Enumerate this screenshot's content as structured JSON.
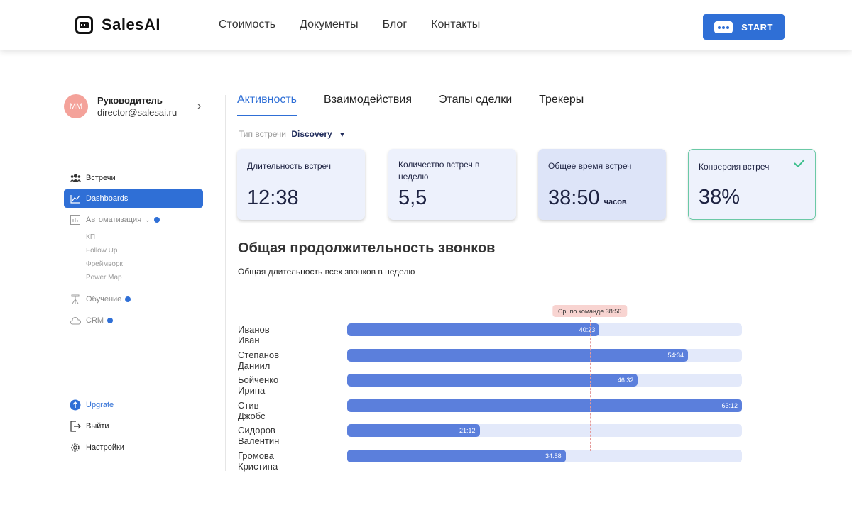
{
  "brand": {
    "name": "SalesAI"
  },
  "nav": [
    "Стоимость",
    "Документы",
    "Блог",
    "Контакты"
  ],
  "start_button": "START",
  "profile": {
    "initials": "MM",
    "role": "Руководитель",
    "email": "director@salesai.ru"
  },
  "sidebar": {
    "items": [
      {
        "label": "Встречи",
        "icon": "users-icon"
      },
      {
        "label": "Dashboards",
        "icon": "chart-line-icon",
        "active": true
      },
      {
        "label": "Автоматизация",
        "icon": "automation-icon"
      }
    ],
    "sub_items": [
      "КП",
      "Follow Up",
      "Фреймворк",
      "Power Map"
    ],
    "training": "Обучение",
    "crm": "CRM",
    "upgrade": "Upgrate",
    "logout": "Выйти",
    "settings": "Настройки"
  },
  "tabs": [
    "Активность",
    "Взаимодействия",
    "Этапы сделки",
    "Трекеры"
  ],
  "meeting_type": {
    "label": "Тип встречи",
    "value": "Discovery"
  },
  "cards": [
    {
      "title": "Длительность встреч",
      "value": "12:38",
      "unit": ""
    },
    {
      "title": "Количество встреч в неделю",
      "value": "5,5",
      "unit": ""
    },
    {
      "title": "Общее время встреч",
      "value": "38:50",
      "unit": "часов"
    },
    {
      "title": "Конверсия встреч",
      "value": "38%",
      "unit": ""
    }
  ],
  "section": {
    "title": "Общая продолжительность звонков",
    "subtitle": "Общая длительность всех звонков в неделю"
  },
  "chart_data": {
    "type": "bar",
    "orientation": "horizontal",
    "categories": [
      "Иванов Иван",
      "Степанов Даниил",
      "Бойченко Ирина",
      "Стив Джобс",
      "Сидоров Валентин",
      "Громова Кристина"
    ],
    "value_labels": [
      "40:23",
      "54:34",
      "46:32",
      "63:12",
      "21:12",
      "34:58"
    ],
    "values_minutes": [
      2423,
      3274,
      2792,
      3792,
      1272,
      2098
    ],
    "xlim": [
      0,
      3792
    ],
    "average": {
      "label": "Ср. по команде 38:50",
      "value_minutes": 2330
    },
    "colors": {
      "fill": "#5b7fdc",
      "track": "#e3e9fa",
      "average": "#f8d4d1"
    }
  }
}
